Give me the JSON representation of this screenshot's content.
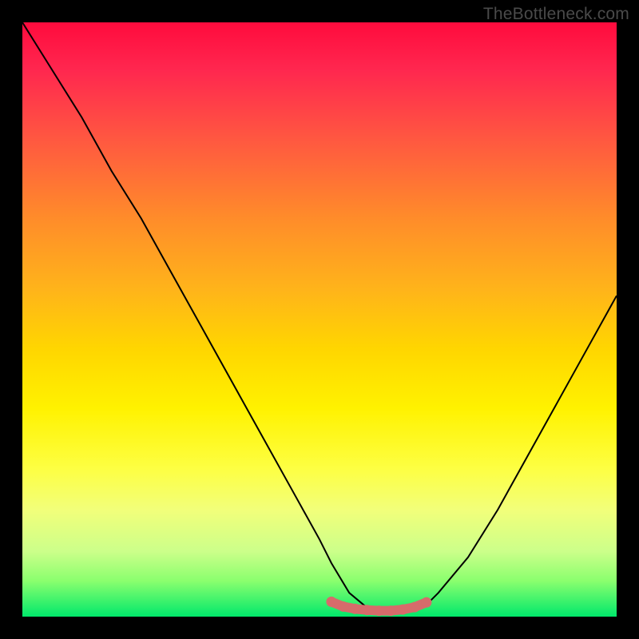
{
  "watermark": "TheBottleneck.com",
  "chart_data": {
    "type": "line",
    "title": "",
    "xlabel": "",
    "ylabel": "",
    "xlim": [
      0,
      100
    ],
    "ylim": [
      0,
      100
    ],
    "series": [
      {
        "name": "bottleneck-curve",
        "x": [
          0,
          5,
          10,
          15,
          20,
          25,
          30,
          35,
          40,
          45,
          50,
          52,
          55,
          58,
          60,
          63,
          65,
          68,
          70,
          75,
          80,
          85,
          90,
          95,
          100
        ],
        "y": [
          100,
          92,
          84,
          75,
          67,
          58,
          49,
          40,
          31,
          22,
          13,
          9,
          4,
          1.5,
          1,
          1,
          1.2,
          2,
          4,
          10,
          18,
          27,
          36,
          45,
          54
        ]
      },
      {
        "name": "optimal-zone-marker",
        "x": [
          52,
          54,
          56,
          58,
          60,
          62,
          64,
          66,
          68
        ],
        "y": [
          2.5,
          1.7,
          1.3,
          1.1,
          1.0,
          1.0,
          1.2,
          1.6,
          2.4
        ]
      }
    ],
    "annotations": []
  }
}
